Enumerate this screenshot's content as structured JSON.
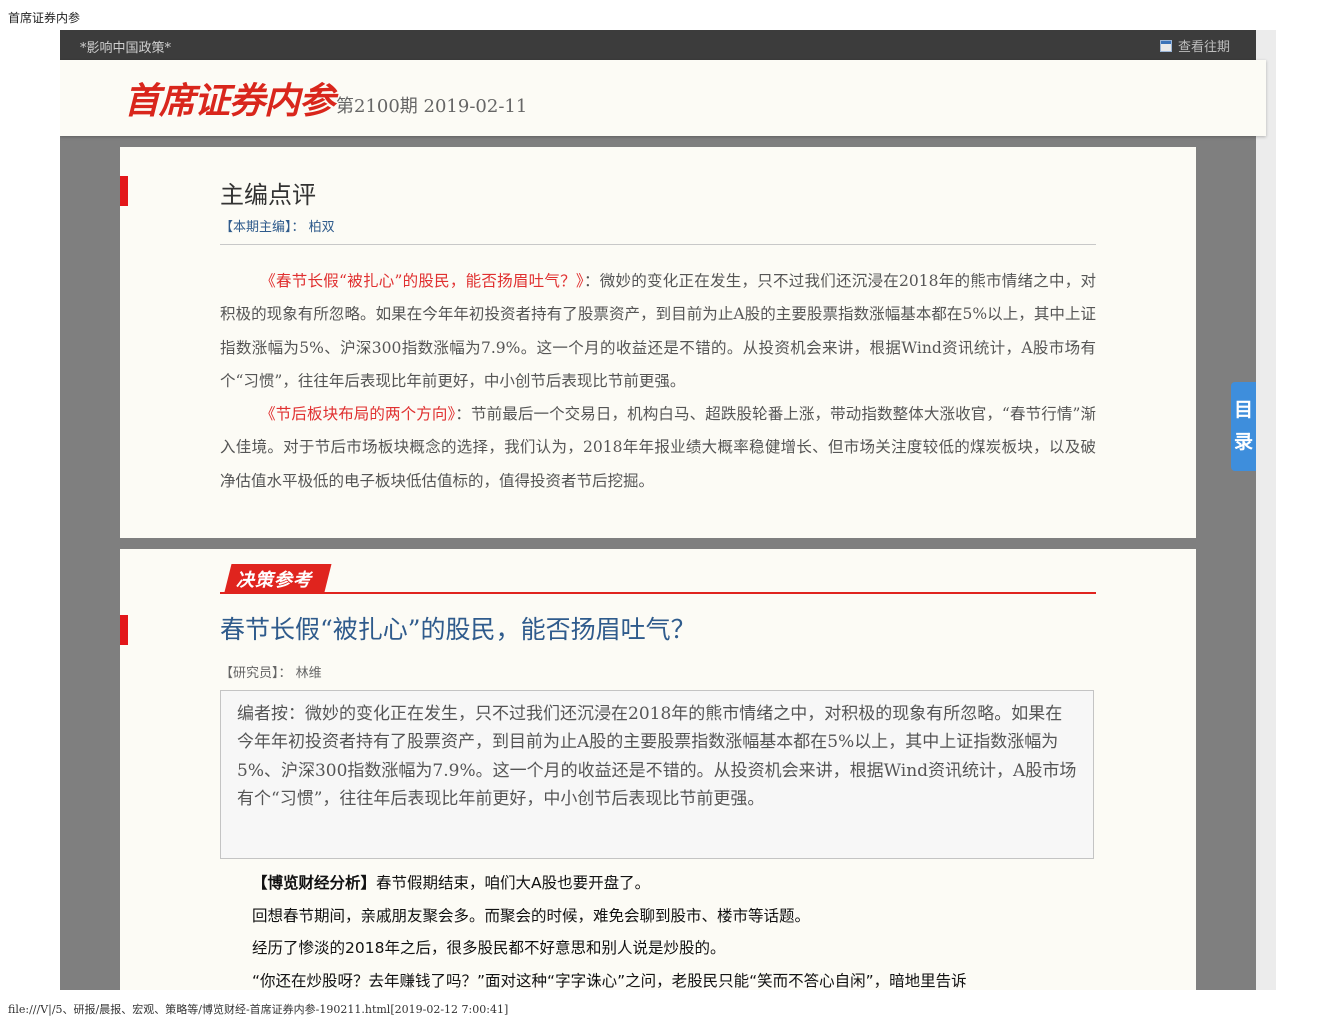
{
  "document": {
    "title": "首席证券内参",
    "footer_path": "file:///V|/5、研报/晨报、宏观、策略等/博览财经-首席证券内参-190211.html[2019-02-12 7:00:41]"
  },
  "top_bar": {
    "slogan": "*影响中国政策*",
    "archive_link": "查看往期",
    "archive_icon": "calendar-icon"
  },
  "header": {
    "logo": "首席证券内参",
    "issue": "第2100期 2019-02-11"
  },
  "editor_section": {
    "title": "主编点评",
    "editor_label": "【本期主编】：",
    "editor_name": "柏双",
    "item1_link": "《春节长假“被扎心”的股民，能否扬眉吐气？》",
    "item1_text": "：微妙的变化正在发生，只不过我们还沉浸在2018年的熊市情绪之中，对积极的现象有所忽略。如果在今年年初投资者持有了股票资产，到目前为止A股的主要股票指数涨幅基本都在5%以上，其中上证指数涨幅为5%、沪深300指数涨幅为7.9%。这一个月的收益还是不错的。从投资机会来讲，根据Wind资讯统计，A股市场有个“习惯”，往往年后表现比年前更好，中小创节后表现比节前更强。",
    "item2_link": "《节后板块布局的两个方向》",
    "item2_text": "：节前最后一个交易日，机构白马、超跌股轮番上涨，带动指数整体大涨收官，“春节行情”渐入佳境。对于节后市场板块概念的选择，我们认为，2018年年报业绩大概率稳健增长、但市场关注度较低的煤炭板块，以及破净估值水平极低的电子板块低估值标的，值得投资者节后挖掘。"
  },
  "article": {
    "badge": "决策参考",
    "title": "春节长假“被扎心”的股民，能否扬眉吐气？",
    "researcher_label": "【研究员】：",
    "researcher_name": "林维",
    "note": "编者按：微妙的变化正在发生，只不过我们还沉浸在2018年的熊市情绪之中，对积极的现象有所忽略。如果在今年年初投资者持有了股票资产，到目前为止A股的主要股票指数涨幅基本都在5%以上，其中上证指数涨幅为5%、沪深300指数涨幅为7.9%。这一个月的收益还是不错的。从投资机会来讲，根据Wind资讯统计，A股市场有个“习惯”，往往年后表现比年前更好，中小创节后表现比节前更强。",
    "body_lead": "【博览财经分析】",
    "body_line1": "春节假期结束，咱们大A股也要开盘了。",
    "body_line2": "回想春节期间，亲戚朋友聚会多。而聚会的时候，难免会聊到股市、楼市等话题。",
    "body_line3": "经历了惨淡的2018年之后，很多股民都不好意思和别人说是炒股的。",
    "body_line4": "“你还在炒股呀？去年赚钱了吗？”面对这种“字字诛心”之问，老股民只能“笑而不答心自闲”，暗地里告诉"
  },
  "toc": {
    "char1": "目",
    "char2": "录"
  },
  "colors": {
    "accent_red": "#e0241e",
    "link_blue": "#2f5b8c",
    "toc_blue": "#3e8edc",
    "top_bar": "#3c3c3c"
  }
}
